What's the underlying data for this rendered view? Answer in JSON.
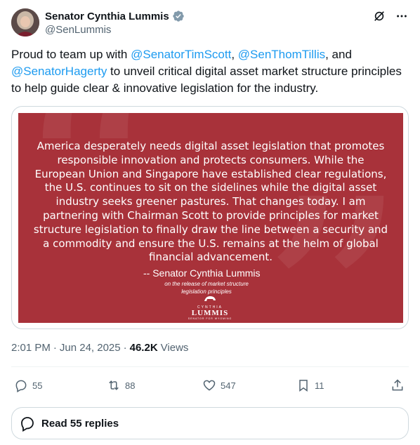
{
  "author": {
    "display_name": "Senator Cynthia Lummis",
    "handle": "@SenLummis"
  },
  "tweet": {
    "text_parts": {
      "p1": "Proud to team up with ",
      "m1": "@SenatorTimScott",
      "p2": ", ",
      "m2": "@SenThomTillis",
      "p3": ", and ",
      "m3": "@SenatorHagerty",
      "p4": " to unveil critical digital asset market structure principles to help guide clear & innovative legislation for the industry."
    }
  },
  "media": {
    "quote": "America desperately needs digital asset legislation that promotes responsible innovation and protects consumers. While the European Union and Singapore have established clear regulations, the U.S. continues to sit on the sidelines while the digital asset industry seeks greener pastures. That changes today. I am partnering with Chairman Scott to provide principles for market structure legislation to finally draw the line between a security and a commodity and ensure the U.S. remains at the helm of global financial advancement.",
    "attribution": "-- Senator Cynthia Lummis",
    "attribution_sub": "on the release of market structure legislation principles",
    "logo_top": "CYNTHIA",
    "logo_main": "LUMMIS",
    "logo_sub": "SENATOR FOR WYOMING",
    "background_color": "#a8323a"
  },
  "meta": {
    "time": "2:01 PM",
    "sep1": "·",
    "date": "Jun 24, 2025",
    "sep2": "·",
    "views_count": "46.2K",
    "views_label": "Views"
  },
  "actions": {
    "replies": "55",
    "reposts": "88",
    "likes": "547",
    "bookmarks": "11"
  },
  "read_replies": {
    "label": "Read 55 replies"
  },
  "colors": {
    "accent": "#1d9bf0",
    "secondary_text": "#536471",
    "border": "#cfd9de"
  }
}
